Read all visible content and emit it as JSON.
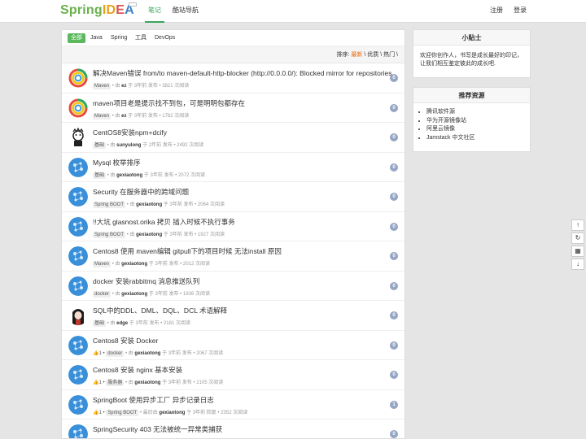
{
  "header": {
    "logo_spring": "Spring",
    "logo_i": "I",
    "logo_d": "D",
    "logo_e": "E",
    "logo_a": "A",
    "nav": [
      "笔记",
      "酷站导航"
    ],
    "register": "注册",
    "login": "登录"
  },
  "tabs": [
    "全部",
    "Java",
    "Spring",
    "工具",
    "DevOps"
  ],
  "sort": {
    "label": "排序:",
    "latest": "最新",
    "sep1": "\\",
    "quality": "优质",
    "sep2": "\\",
    "hot": "热门",
    "sep3": "\\"
  },
  "topics": [
    {
      "title": "解决Maven错误 from/to maven-default-http-blocker (http://0.0.0.0/): Blocked mirror for repositories",
      "likes": "",
      "tag": "Maven",
      "pre": "• 由",
      "user": "ez",
      "post": "于 3年前 发布 • 3821 次阅读",
      "count": "0",
      "avatar": "spiral"
    },
    {
      "title": "maven项目老是提示找不到包，可是明明包都存在",
      "likes": "",
      "tag": "Maven",
      "pre": "• 由",
      "user": "ez",
      "post": "于 3年前 发布 • 1782 次阅读",
      "count": "0",
      "avatar": "spiral"
    },
    {
      "title": "CentOS8安装npm+dcify",
      "likes": "",
      "tag": "基础",
      "pre": "• 由",
      "user": "sunyulong",
      "post": "于 2年前 发布 • 2492 次阅读",
      "count": "0",
      "avatar": "face"
    },
    {
      "title": "Mysql 枚举排序",
      "likes": "",
      "tag": "基础",
      "pre": "• 由",
      "user": "gexiaotong",
      "post": "于 3年前 发布 • 2072 次阅读",
      "count": "0",
      "avatar": "blue"
    },
    {
      "title": "Security 在服务器中的跨域问题",
      "likes": "",
      "tag": "Spring BOOT",
      "pre": "• 由",
      "user": "gexiaotong",
      "post": "于 3年前 发布 • 2064 次阅读",
      "count": "0",
      "avatar": "blue"
    },
    {
      "title": "!!大坑 glasnost.orika 拷贝 插入时候不执行事务",
      "likes": "",
      "tag": "Spring BOOT",
      "pre": "• 由",
      "user": "gexiaotong",
      "post": "于 3年前 发布 • 1927 次阅读",
      "count": "0",
      "avatar": "blue"
    },
    {
      "title": "Centos8 使用 maven编辑 gitpull下的项目时候 无法install 原因",
      "likes": "",
      "tag": "Maven",
      "pre": "• 由",
      "user": "gexiaotong",
      "post": "于 3年前 发布 • 2012 次阅读",
      "count": "0",
      "avatar": "blue"
    },
    {
      "title": "docker 安装rabbitmq 消息推送队列",
      "likes": "",
      "tag": "docker",
      "pre": "• 由",
      "user": "gexiaotong",
      "post": "于 3年前 发布 • 1936 次阅读",
      "count": "0",
      "avatar": "blue"
    },
    {
      "title": "SQL中的DDL、DML、DQL、DCL 术语解释",
      "likes": "",
      "tag": "基础",
      "pre": "• 由",
      "user": "edge",
      "post": "于 3年前 发布 • 2181 次阅读",
      "count": "0",
      "avatar": "anime"
    },
    {
      "title": "Centos8 安装 Docker",
      "likes": "1",
      "tag": "docker",
      "pre": "• 由",
      "user": "gexiaotong",
      "post": "于 3年前 发布 • 2067 次阅读",
      "count": "0",
      "avatar": "blue"
    },
    {
      "title": "Centos8 安装 nginx 基本安装",
      "likes": "1",
      "tag": "服务器",
      "pre": "• 由",
      "user": "gexiaotong",
      "post": "于 3年前 发布 • 2105 次阅读",
      "count": "0",
      "avatar": "blue"
    },
    {
      "title": "SpringBoot 使用异步工厂 异步记录日志",
      "likes": "1",
      "tag": "Spring BOOT",
      "pre": "• 最后由",
      "user": "gexiaotong",
      "post": "于 3年前 回复 • 2352 次阅读",
      "count": "1",
      "avatar": "blue"
    },
    {
      "title": "SpringSecurity 403 无法被统一异常类捕获",
      "likes": "",
      "tag": "",
      "pre": "",
      "user": "",
      "post": "",
      "count": "0",
      "avatar": "blue"
    }
  ],
  "tips": {
    "title": "小贴士",
    "body": "欢迎你创作人，书写是成长最好的印记，让我们相互鉴定彼此的成长吧."
  },
  "resources": {
    "title": "推荐资源",
    "items": [
      "腾讯软件源",
      "华为开源镜像站",
      "阿里云镜像",
      "Jamstack 中文社区"
    ]
  },
  "float_tools": [
    "↑",
    "↻",
    "▦",
    "↓"
  ],
  "colors": {
    "accent": "#3ba55c",
    "tab_active": "#5cb85c",
    "hot": "#e8660d",
    "count_badge": "#95a5c4"
  }
}
